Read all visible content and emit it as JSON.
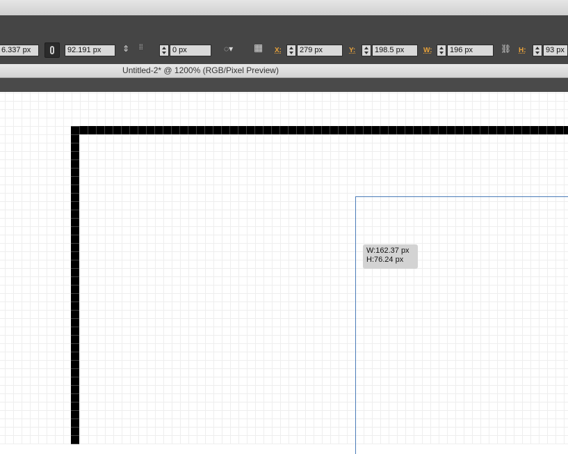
{
  "control_bar": {
    "width_partial": "6.337 px",
    "height_value": "92.191 px",
    "spacing_value": "0 px",
    "x_label": "X:",
    "x_value": "279 px",
    "y_label": "Y:",
    "y_value": "198.5 px",
    "w_label": "W:",
    "w_value": "196 px",
    "h_label": "H:",
    "h_value": "93 px"
  },
  "document": {
    "tab_title": "Untitled-2* @ 1200% (RGB/Pixel Preview)"
  },
  "tooltip": {
    "width_text": "W:162.37 px",
    "height_text": "H:76.24 px"
  },
  "colors": {
    "label_accent": "#e8a23a",
    "selection_outline": "#4a7bb8",
    "panel_dark": "#454545"
  }
}
